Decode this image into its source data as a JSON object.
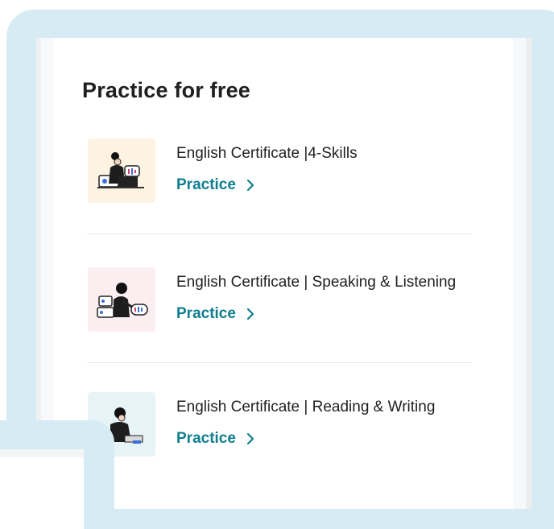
{
  "section": {
    "title": "Practice for free"
  },
  "items": [
    {
      "title": "English Certificate |4-Skills",
      "link_label": "Practice",
      "icon": "person-at-laptop-illustration",
      "tint": "#fdf3e2"
    },
    {
      "title": "English Certificate | Speaking & Listening",
      "link_label": "Practice",
      "icon": "person-speaking-illustration",
      "tint": "#fbeef0"
    },
    {
      "title": "English Certificate | Reading & Writing",
      "link_label": "Practice",
      "icon": "person-writing-illustration",
      "tint": "#e6f3f7"
    }
  ],
  "colors": {
    "frame": "#d6ebf3",
    "link": "#0f7e8f",
    "text": "#1f1f1f"
  }
}
